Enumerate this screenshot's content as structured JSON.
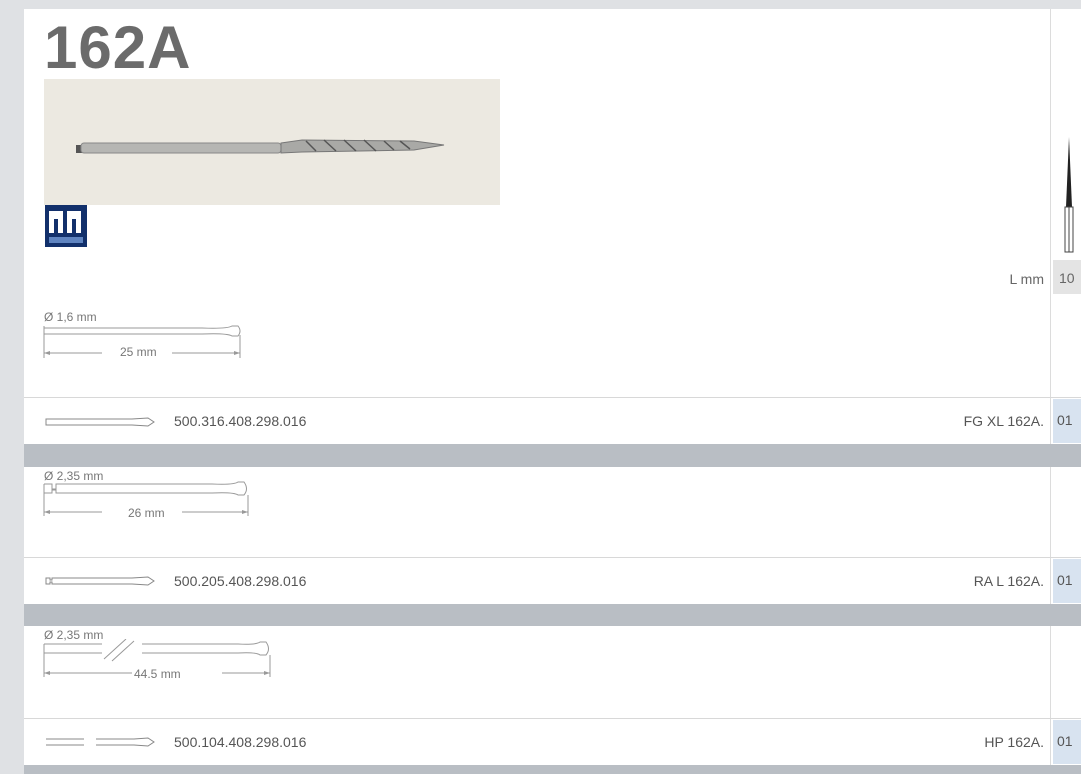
{
  "product": {
    "code": "162A"
  },
  "spec_table": {
    "l_mm_label": "L mm",
    "l_mm_value": "10"
  },
  "sections": [
    {
      "diameter": "Ø 1,6 mm",
      "length": "25 mm",
      "ref_code": "500.316.408.298.016",
      "type_label": "FG XL 162A.",
      "tag": "01"
    },
    {
      "diameter": "Ø 2,35 mm",
      "length": "26 mm",
      "ref_code": "500.205.408.298.016",
      "type_label": "RA L 162A.",
      "tag": "01"
    },
    {
      "diameter": "Ø 2,35 mm",
      "length": "44.5 mm",
      "ref_code": "500.104.408.298.016",
      "type_label": "HP 162A.",
      "tag": "01"
    }
  ],
  "colors": {
    "band": "#b9bec4",
    "tag_bg": "#d8e3f0",
    "title": "#6b6b6b"
  }
}
